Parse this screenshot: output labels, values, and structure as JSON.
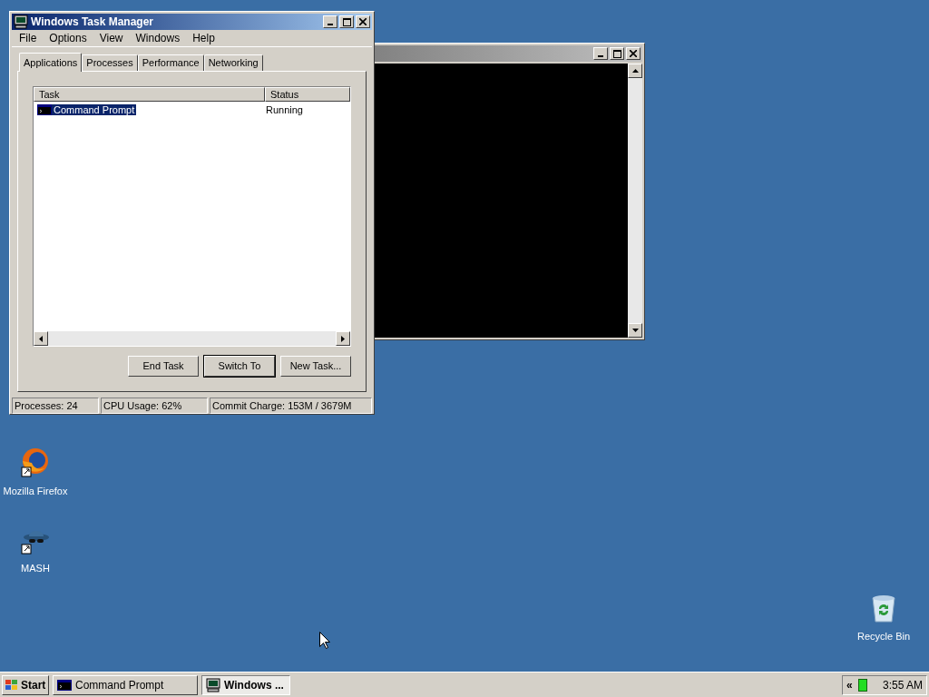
{
  "task_manager": {
    "title": "Windows Task Manager",
    "menu": [
      "File",
      "Options",
      "View",
      "Windows",
      "Help"
    ],
    "tabs": [
      {
        "label": "Applications",
        "selected": true
      },
      {
        "label": "Processes",
        "selected": false
      },
      {
        "label": "Performance",
        "selected": false
      },
      {
        "label": "Networking",
        "selected": false
      }
    ],
    "columns": [
      "Task",
      "Status"
    ],
    "rows": [
      {
        "task": "Command Prompt",
        "status": "Running",
        "selected": true
      }
    ],
    "buttons": [
      {
        "label": "End Task",
        "default": false
      },
      {
        "label": "Switch To",
        "default": true
      },
      {
        "label": "New Task...",
        "default": false
      }
    ],
    "status_bar": [
      "Processes: 24",
      "CPU Usage: 62%",
      "Commit Charge: 153M / 3679M"
    ]
  },
  "desktop_icons": [
    {
      "label": "Mozilla Firefox",
      "kind": "firefox"
    },
    {
      "label": "MASH",
      "kind": "mash"
    },
    {
      "label": "Recycle Bin",
      "kind": "recycle"
    }
  ],
  "taskbar": {
    "start": "Start",
    "buttons": [
      {
        "label": "Command Prompt",
        "kind": "console",
        "selected": false
      },
      {
        "label": "Windows ...",
        "kind": "taskmgr",
        "selected": true
      }
    ],
    "tray_toggle": "«",
    "clock": "3:55 AM"
  }
}
